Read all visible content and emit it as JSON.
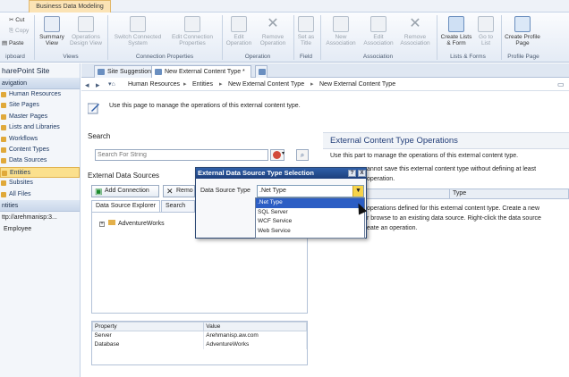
{
  "ribbon": {
    "context_tab": "Business Data Modeling",
    "clipboard": {
      "cut": "Cut",
      "copy": "Copy",
      "paste": "Paste",
      "group": "ipboard"
    },
    "views": {
      "summary": "Summary View",
      "operations": "Operations Design View",
      "group": "Views"
    },
    "connection": {
      "switch": "Switch Connected System",
      "edit": "Edit Connection Properties",
      "group": "Connection Properties"
    },
    "operation": {
      "edit": "Edit Operation",
      "remove": "Remove Operation",
      "group": "Operation"
    },
    "field": {
      "set_title": "Set as Title",
      "group": "Field"
    },
    "association": {
      "new": "New Association",
      "edit": "Edit Association",
      "remove": "Remove Association",
      "group": "Association"
    },
    "lists": {
      "create": "Create Lists & Form",
      "goto": "Go to List",
      "group": "Lists & Forms"
    },
    "profile": {
      "create": "Create Profile Page",
      "group": "Profile Page"
    }
  },
  "nav": {
    "site": "harePoint Site",
    "nav_head": "avigation",
    "items": [
      "Human Resources",
      "Site Pages",
      "Master Pages",
      "Lists and Libraries",
      "Workflows",
      "Content Types",
      "Data Sources",
      "Entities",
      "Subsites",
      "All Files"
    ],
    "entities_head": "ntities",
    "url": "ttp://arehmanisp:3...",
    "entity": "Employee"
  },
  "tabs": [
    "Site Suggestions",
    "New External Content Type *"
  ],
  "breadcrumb": [
    "Human Resources",
    "Entities",
    "New External Content Type",
    "New External Content Type"
  ],
  "page": {
    "info": "Use this page to manage the operations of this external content type.",
    "search_title": "Search",
    "search_placeholder": "Search For String",
    "eds_title": "External Data Sources",
    "add_connection": "Add Connection",
    "remove": "Remo",
    "subtab_explorer": "Data Source Explorer",
    "subtab_results": "Search Re",
    "tree_item": "AdventureWorks",
    "props_headers": [
      "Property",
      "Value"
    ],
    "props_rows": [
      [
        "Server",
        "Arehmanisp.aw.com"
      ],
      [
        "Database",
        "AdventureWorks"
      ]
    ]
  },
  "ect": {
    "title": "External Content Type Operations",
    "desc": "Use this part to manage the operations of this external content type.",
    "warn1": "annot save this external content type without defining at least",
    "warn2": "operation.",
    "type_header": "Type",
    "ops1": "operations defined for this external content type. Create a new",
    "ops2": "r browse to an existing data source. Right-click the data source",
    "ops3": "eate an operation."
  },
  "dialog": {
    "title": "External Data Source Type Selection",
    "help": "?",
    "close": "X",
    "label": "Data Source Type",
    "selected": ".Net Type",
    "options": [
      ".Net Type",
      "SQL Server",
      "WCF Service",
      "Web Service"
    ]
  }
}
